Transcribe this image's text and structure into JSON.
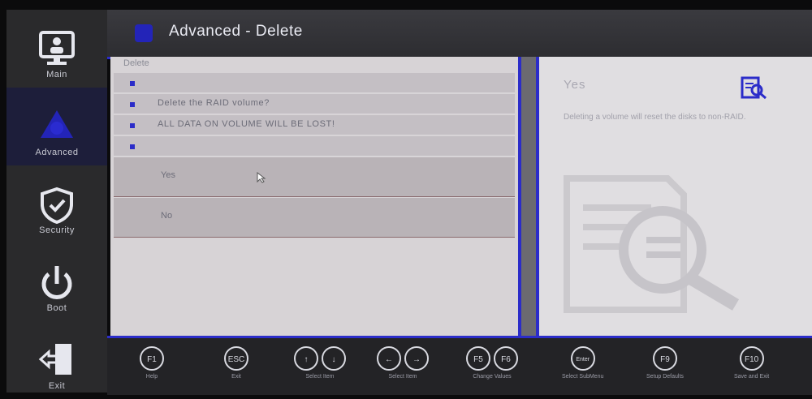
{
  "header": {
    "title": "Advanced - Delete"
  },
  "sidebar": {
    "items": [
      {
        "label": "Main",
        "icon": "monitor-icon"
      },
      {
        "label": "Advanced",
        "icon": "advanced-icon"
      },
      {
        "label": "Security",
        "icon": "shield-icon"
      },
      {
        "label": "Boot",
        "icon": "power-icon"
      },
      {
        "label": "Exit",
        "icon": "exit-icon"
      }
    ]
  },
  "main": {
    "heading": "Delete",
    "rows": [
      "",
      "Delete the RAID volume?",
      "ALL DATA ON VOLUME WILL BE LOST!",
      ""
    ],
    "options": [
      "Yes",
      "No"
    ]
  },
  "help": {
    "title": "Yes",
    "description": "Deleting a volume will reset the disks to non-RAID."
  },
  "footer": {
    "keys": [
      {
        "keys": [
          "F1"
        ],
        "caption": "Help"
      },
      {
        "keys": [
          "ESC"
        ],
        "caption": "Exit"
      },
      {
        "keys": [
          "↑",
          "↓"
        ],
        "caption": "Select Item"
      },
      {
        "keys": [
          "←",
          "→"
        ],
        "caption": "Select Item"
      },
      {
        "keys": [
          "F5",
          "F6"
        ],
        "caption": "Change Values"
      },
      {
        "keys": [
          "Enter"
        ],
        "caption": "Select SubMenu"
      },
      {
        "keys": [
          "F9"
        ],
        "caption": "Setup Defaults"
      },
      {
        "keys": [
          "F10"
        ],
        "caption": "Save and Exit"
      }
    ]
  },
  "colors": {
    "accent": "#2b2cc9",
    "panel": "#d7d3d6",
    "sidebar": "#2a2a2c"
  }
}
